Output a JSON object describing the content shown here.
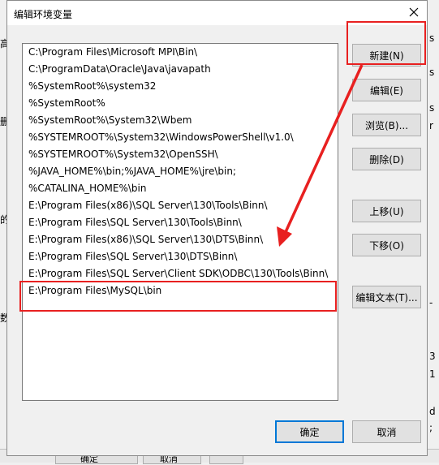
{
  "background_window": {
    "left_fragments": [
      "高",
      "",
      "",
      "删",
      "",
      "",
      "的",
      "",
      "数"
    ],
    "right_fragments": [
      "s",
      "",
      "s",
      "",
      "s",
      "r",
      "",
      "",
      "",
      "-",
      "",
      "3",
      "1",
      "",
      "d",
      ";"
    ],
    "bottom_fragments": [
      "确定",
      "取消"
    ]
  },
  "dialog": {
    "title": "编辑环境变量",
    "paths": [
      "C:\\Program Files\\Microsoft MPI\\Bin\\",
      "C:\\ProgramData\\Oracle\\Java\\javapath",
      "%SystemRoot%\\system32",
      "%SystemRoot%",
      "%SystemRoot%\\System32\\Wbem",
      "%SYSTEMROOT%\\System32\\WindowsPowerShell\\v1.0\\",
      "%SYSTEMROOT%\\System32\\OpenSSH\\",
      "%JAVA_HOME%\\bin;%JAVA_HOME%\\jre\\bin;",
      "%CATALINA_HOME%\\bin",
      "E:\\Program Files(x86)\\SQL Server\\130\\Tools\\Binn\\",
      "E:\\Program Files\\SQL Server\\130\\Tools\\Binn\\",
      "E:\\Program Files(x86)\\SQL Server\\130\\DTS\\Binn\\",
      "E:\\Program Files\\SQL Server\\130\\DTS\\Binn\\",
      "E:\\Program Files\\SQL Server\\Client SDK\\ODBC\\130\\Tools\\Binn\\",
      "E:\\Program Files\\MySQL\\bin"
    ],
    "buttons": {
      "new": "新建(N)",
      "edit": "编辑(E)",
      "browse": "浏览(B)...",
      "delete": "删除(D)",
      "move_up": "上移(U)",
      "move_down": "下移(O)",
      "edit_text": "编辑文本(T)...",
      "ok": "确定",
      "cancel": "取消"
    }
  },
  "colors": {
    "annotation_red": "#e82020",
    "focus_blue": "#0078d7"
  }
}
